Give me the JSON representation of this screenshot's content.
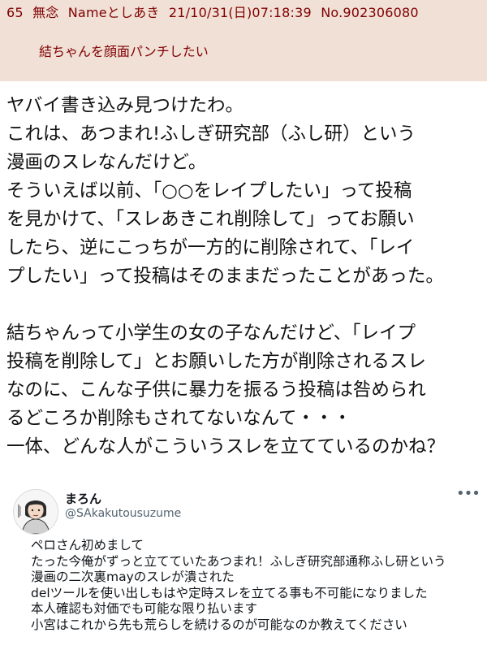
{
  "post": {
    "number": "65",
    "subject": "無念",
    "name": "Nameとしあき",
    "datetime": "21/10/31(日)07:18:39",
    "post_no": "No.902306080",
    "comment": "結ちゃんを顔面パンチしたい"
  },
  "body": {
    "lines": [
      "ヤバイ書き込み見つけたわ。",
      "これは、あつまれ!ふしぎ研究部（ふし研）という",
      "漫画のスレなんだけど。",
      "そういえば以前、「○○をレイプしたい」って投稿",
      "を見かけて、「スレあきこれ削除して」ってお願い",
      "したら、逆にこっちが一方的に削除されて、「レイ",
      "プしたい」って投稿はそのままだったことがあった。",
      "",
      "結ちゃんって小学生の女の子なんだけど、「レイプ",
      "投稿を削除して」とお願いした方が削除されるスレ",
      "なのに、こんな子供に暴力を振るう投稿は咎められ",
      "るどころか削除もされてないなんて・・・",
      "一体、どんな人がこういうスレを立てているのかね？"
    ]
  },
  "tweet": {
    "display_name": "まろん",
    "handle": "@SAkakutousuzume",
    "more_icon": "more-horizontal-icon",
    "lines": [
      "ペロさん初めまして",
      "たった今俺がずっと立てていたあつまれ！ふしぎ研究部通称ふし研という",
      "漫画の二次裏mayのスレが潰された",
      "delツールを使い出しもはや定時スレを立てる事も不可能になりました",
      "本人確認も対価でも可能な限り払います",
      "小宮はこれから先も荒らしを続けるのが可能なのか教えてください"
    ]
  },
  "colors": {
    "post_background": "#f0e0d6",
    "post_text": "#800000",
    "body_text": "#111111",
    "tweet_handle": "#536471"
  }
}
